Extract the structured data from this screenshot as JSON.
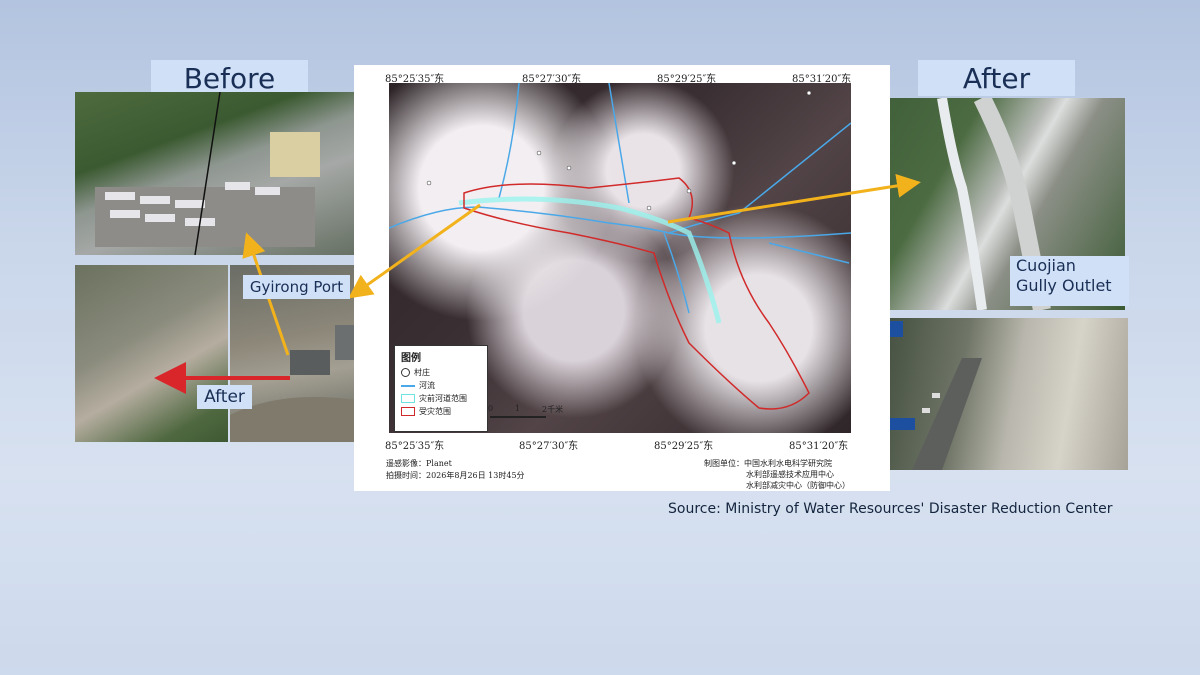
{
  "labels": {
    "before": "Before",
    "after_right": "After",
    "gyirong_port": "Gyirong Port",
    "after_small": "After",
    "cuojian_line1": "Cuojian",
    "cuojian_line2": "Gully Outlet",
    "source": "Source: Ministry of Water Resources' Disaster Reduction Center"
  },
  "map": {
    "top_coords": [
      "85°25′35″东",
      "85°27′30″东",
      "85°29′25″东",
      "85°31′20″东"
    ],
    "bottom_coords": [
      "85°25′35″东",
      "85°27′30″东",
      "85°29′25″东",
      "85°31′20″东"
    ],
    "legend": {
      "title": "图例",
      "village": "村庄",
      "river": "河流",
      "pre_disaster": "灾前河道范围",
      "affected": "受灾范围",
      "scale": [
        "0",
        "1",
        "2千米"
      ]
    },
    "footer_left_line1": "遥感影像：Planet",
    "footer_left_line2": "拍摄时间：2026年8月26日 13时45分",
    "footer_right_line1": "制图单位：中国水利水电科学研究院",
    "footer_right_line2": "水利部遥感技术应用中心",
    "footer_right_line3": "水利部减灾中心（防御中心）"
  },
  "colors": {
    "label_bg": "#cfe0f7",
    "arrow_yellow": "#f2b21c",
    "arrow_red": "#d8262b",
    "affected_outline": "#d12a2a",
    "river": "#4aa8e8"
  }
}
